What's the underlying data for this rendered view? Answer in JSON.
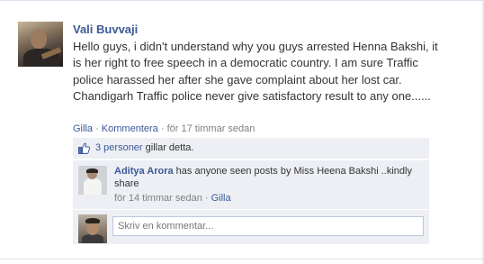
{
  "post": {
    "author": "Vali Buvvaji",
    "text": "Hello guys, i didn't understand why you guys arrested Henna Bakshi, it is her right to free speech in a democratic country. I am sure Traffic police harassed her after she gave complaint about her lost car. Chandigarh Traffic police never give satisfactory result to any one......",
    "like_label": "Gilla",
    "separator": " · ",
    "comment_label": "Kommentera",
    "timestamp": "för 17 timmar sedan"
  },
  "likes": {
    "count_link": "3 personer",
    "suffix": " gillar detta."
  },
  "comments": [
    {
      "author": "Aditya Arora",
      "text": " has anyone seen posts by Miss Heena Bakshi ..kindly share",
      "timestamp": "för 14 timmar sedan",
      "separator": " · ",
      "like_label": "Gilla"
    }
  ],
  "composer": {
    "placeholder": "Skriv en kommentar..."
  },
  "colors": {
    "link": "#3b5998",
    "ufi_background": "#edeff4",
    "meta_text": "#808080"
  },
  "icons": {
    "like": "thumbs-up-icon"
  }
}
